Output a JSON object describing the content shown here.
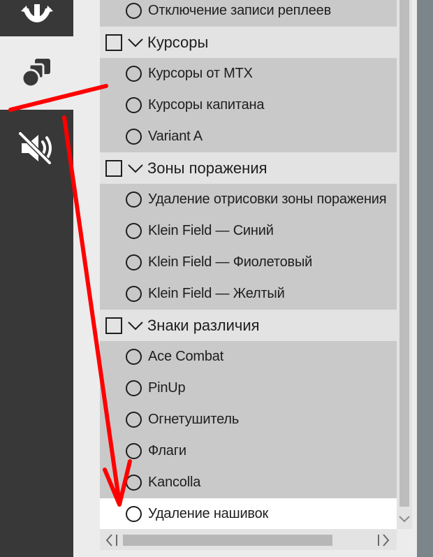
{
  "sidebar": {
    "tabs": [
      {
        "icon": "anchor-icon",
        "active": false
      },
      {
        "icon": "cursor-shapes-icon",
        "active": true
      },
      {
        "icon": "sound-off-icon",
        "active": false
      }
    ]
  },
  "list": {
    "rows": [
      {
        "type": "item",
        "label": "Отключение записи реплеев"
      },
      {
        "type": "header",
        "label": "Курсоры"
      },
      {
        "type": "item",
        "label": "Курсоры от MTX"
      },
      {
        "type": "item",
        "label": "Курсоры капитана"
      },
      {
        "type": "item",
        "label": "Variant A"
      },
      {
        "type": "header",
        "label": "Зоны поражения"
      },
      {
        "type": "item",
        "label": "Удаление отрисовки зоны поражения"
      },
      {
        "type": "item",
        "label": "Klein Field — Синий"
      },
      {
        "type": "item",
        "label": "Klein Field — Фиолетовый"
      },
      {
        "type": "item",
        "label": "Klein Field — Желтый"
      },
      {
        "type": "header",
        "label": "Знаки различия"
      },
      {
        "type": "item",
        "label": "Ace Combat"
      },
      {
        "type": "item",
        "label": "PinUp"
      },
      {
        "type": "item",
        "label": "Огнетушитель"
      },
      {
        "type": "item",
        "label": "Флаги"
      },
      {
        "type": "item",
        "label": "Kancolla"
      },
      {
        "type": "selected",
        "label": "Удаление нашивок"
      }
    ]
  },
  "colors": {
    "annotation": "#ff0000",
    "sidebar": "#383838",
    "item_bg": "#c9c9c9",
    "header_bg": "#e3e3e3",
    "selected_bg": "#ffffff"
  }
}
